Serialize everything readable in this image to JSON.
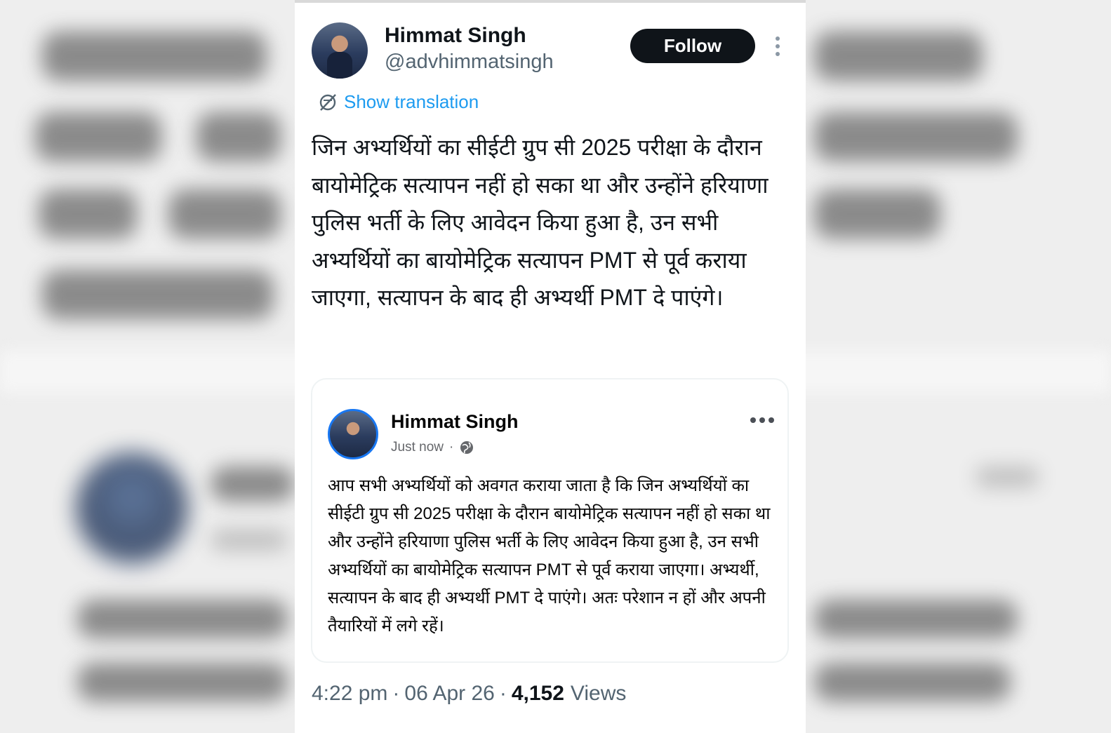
{
  "tweet": {
    "author_name": "Himmat Singh",
    "handle": "@advhimmatsingh",
    "follow_label": "Follow",
    "translate_label": "Show translation",
    "text": "जिन अभ्यर्थियों का सीईटी ग्रुप सी 2025 परीक्षा के दौरान बायोमेट्रिक सत्यापन नहीं हो सका था और उन्होंने हरियाणा पुलिस भर्ती के लिए आवेदन किया हुआ है, उन सभी अभ्यर्थियों का बायोमेट्रिक सत्यापन PMT से पूर्व कराया जाएगा, सत्यापन के बाद ही अभ्यर्थी PMT दे पाएंगे।",
    "time": "4:22 pm",
    "date": "06 Apr 26",
    "views_count": "4,152",
    "views_label": "Views",
    "separator": "·"
  },
  "quoted_post": {
    "author_name": "Himmat Singh",
    "time_label": "Just now",
    "separator": "·",
    "text": "आप सभी अभ्यर्थियों को अवगत कराया जाता है कि जिन अभ्यर्थियों का सीईटी ग्रुप सी 2025 परीक्षा के दौरान बायोमेट्रिक सत्यापन नहीं हो सका था और उन्होंने हरियाणा पुलिस भर्ती के लिए आवेदन किया हुआ है, उन सभी अभ्यर्थियों का बायोमेट्रिक सत्यापन PMT से पूर्व कराया जाएगा। अभ्यर्थी, सत्यापन के बाद ही अभ्यर्थी PMT दे पाएंगे। अतः परेशान न हों और अपनी तैयारियों में लगे रहें।"
  },
  "icons": {
    "more": "vertical-dots-icon",
    "translate": "translate-icon",
    "globe": "globe-icon",
    "quote_more": "horizontal-dots-icon"
  },
  "colors": {
    "link": "#1d9bf0",
    "follow_bg": "#0f1419",
    "muted": "#536471",
    "facebook_blue": "#1877f2"
  }
}
